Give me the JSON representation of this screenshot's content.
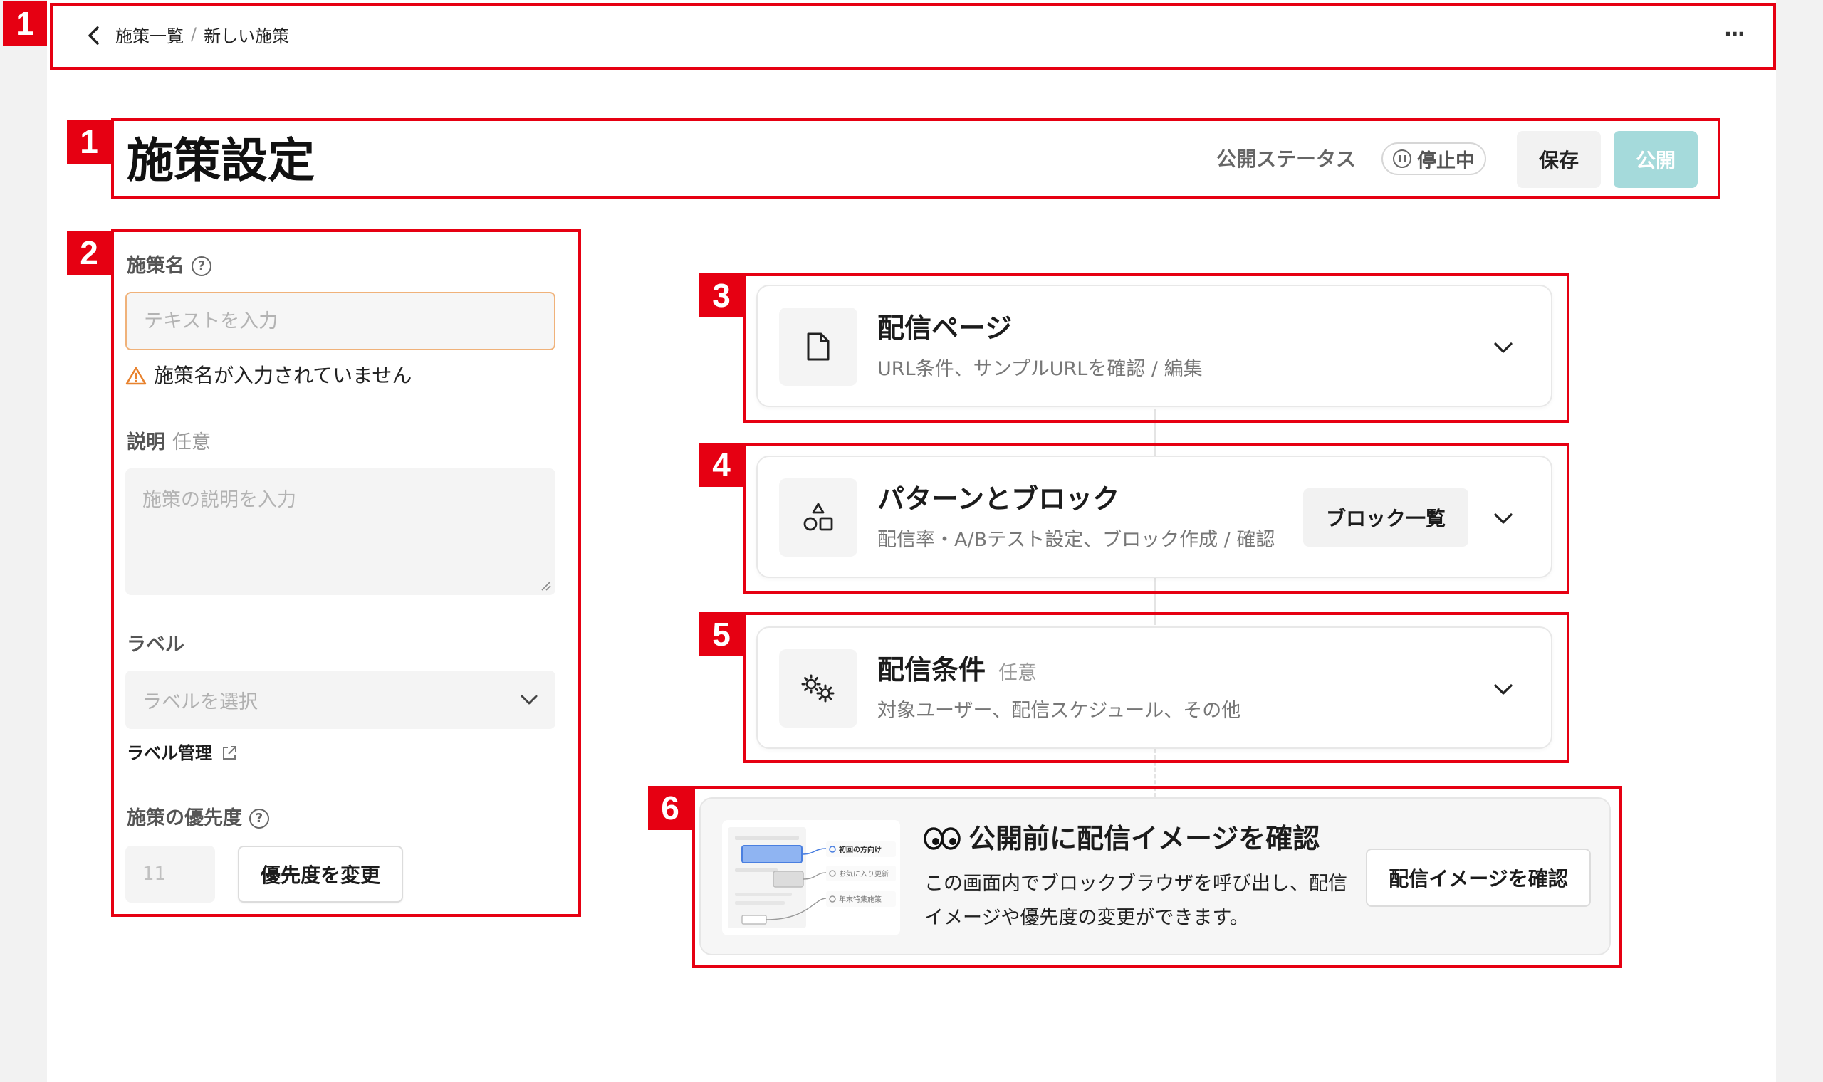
{
  "topbar": {
    "breadcrumb": [
      "施策一覧",
      "新しい施策"
    ],
    "breadcrumb_sep": "/",
    "back_icon": "chevron-left-icon",
    "more_label": "···"
  },
  "header": {
    "title": "施策設定",
    "status_label": "公開ステータス",
    "status_value": "停止中",
    "status_icon": "pause-circle-icon",
    "save_label": "保存",
    "publish_label": "公開",
    "publish_color": "#a5dadb"
  },
  "form": {
    "name": {
      "label": "施策名",
      "placeholder": "テキストを入力",
      "value": "",
      "error": "施策名が入力されていません",
      "error_border": "#f0b27a"
    },
    "description": {
      "label": "説明",
      "optional": "任意",
      "placeholder": "施策の説明を入力",
      "value": ""
    },
    "label": {
      "label": "ラベル",
      "placeholder": "ラベルを選択",
      "manage_link": "ラベル管理"
    },
    "priority": {
      "label": "施策の優先度",
      "value": "11",
      "change_label": "優先度を変更"
    }
  },
  "cards": [
    {
      "title": "配信ページ",
      "subtitle": "URL条件、サンプルURLを確認 / 編集",
      "icon": "document-icon"
    },
    {
      "title": "パターンとブロック",
      "subtitle": "配信率・A/Bテスト設定、ブロック作成 / 確認",
      "icon": "shapes-icon",
      "action_label": "ブロック一覧"
    },
    {
      "title": "配信条件",
      "optional": "任意",
      "subtitle": "対象ユーザー、配信スケジュール、その他",
      "icon": "gears-icon"
    }
  ],
  "preview": {
    "title": "公開前に配信イメージを確認",
    "icon": "eyes-icon",
    "description": "この画面内でブロックブラウザを呼び出し、配信イメージや優先度の変更ができます。",
    "button_label": "配信イメージを確認",
    "thumb_items": [
      "初回の方向け",
      "お気に入り更新",
      "年末特集施策"
    ]
  },
  "annotations": [
    "1",
    "1",
    "2",
    "3",
    "4",
    "5",
    "6"
  ],
  "colors": {
    "annotation": "#e60012",
    "page_bg": "#f2f2f2"
  }
}
